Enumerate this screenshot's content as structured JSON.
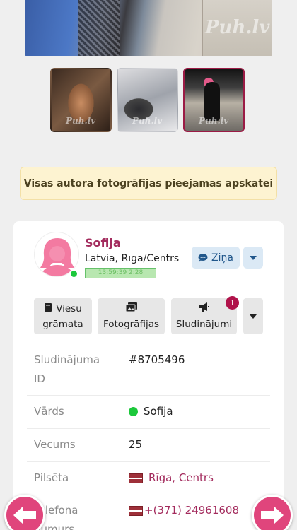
{
  "gallery": {
    "watermark": "Puh.lv",
    "thumbnail_count": 3,
    "selected_thumbnail": 3
  },
  "notice": "Visas autora fotogrāfijas pieejamas apskatei",
  "profile": {
    "name": "Sofija",
    "location": "Latvia, Rīga/Centrs",
    "last_seen": "13:59:39 2:28",
    "message_button": "Ziņa"
  },
  "tabs": {
    "guestbook_line1": "Viesu",
    "guestbook_line2": "grāmata",
    "photos": "Fotogrāfijas",
    "ads": "Sludinājumi",
    "ads_badge": "1"
  },
  "details": {
    "ad_id_label_line1": "Sludinājuma",
    "ad_id_label_line2": "ID",
    "ad_id_value": "#8705496",
    "name_label": "Vārds",
    "name_value": "Sofija",
    "age_label": "Vecums",
    "age_value": "25",
    "city_label": "Pilsēta",
    "city_value": "Rīga, Centrs",
    "phone_label_line1": "Telefona",
    "phone_label_line2": "numurs",
    "phone_value": "+(371) 24961608"
  },
  "colors": {
    "accent": "#a32b5d",
    "nav_arrow": "#e0457c",
    "notice_bg": "#fdf3d1",
    "online": "#1cc83b"
  }
}
